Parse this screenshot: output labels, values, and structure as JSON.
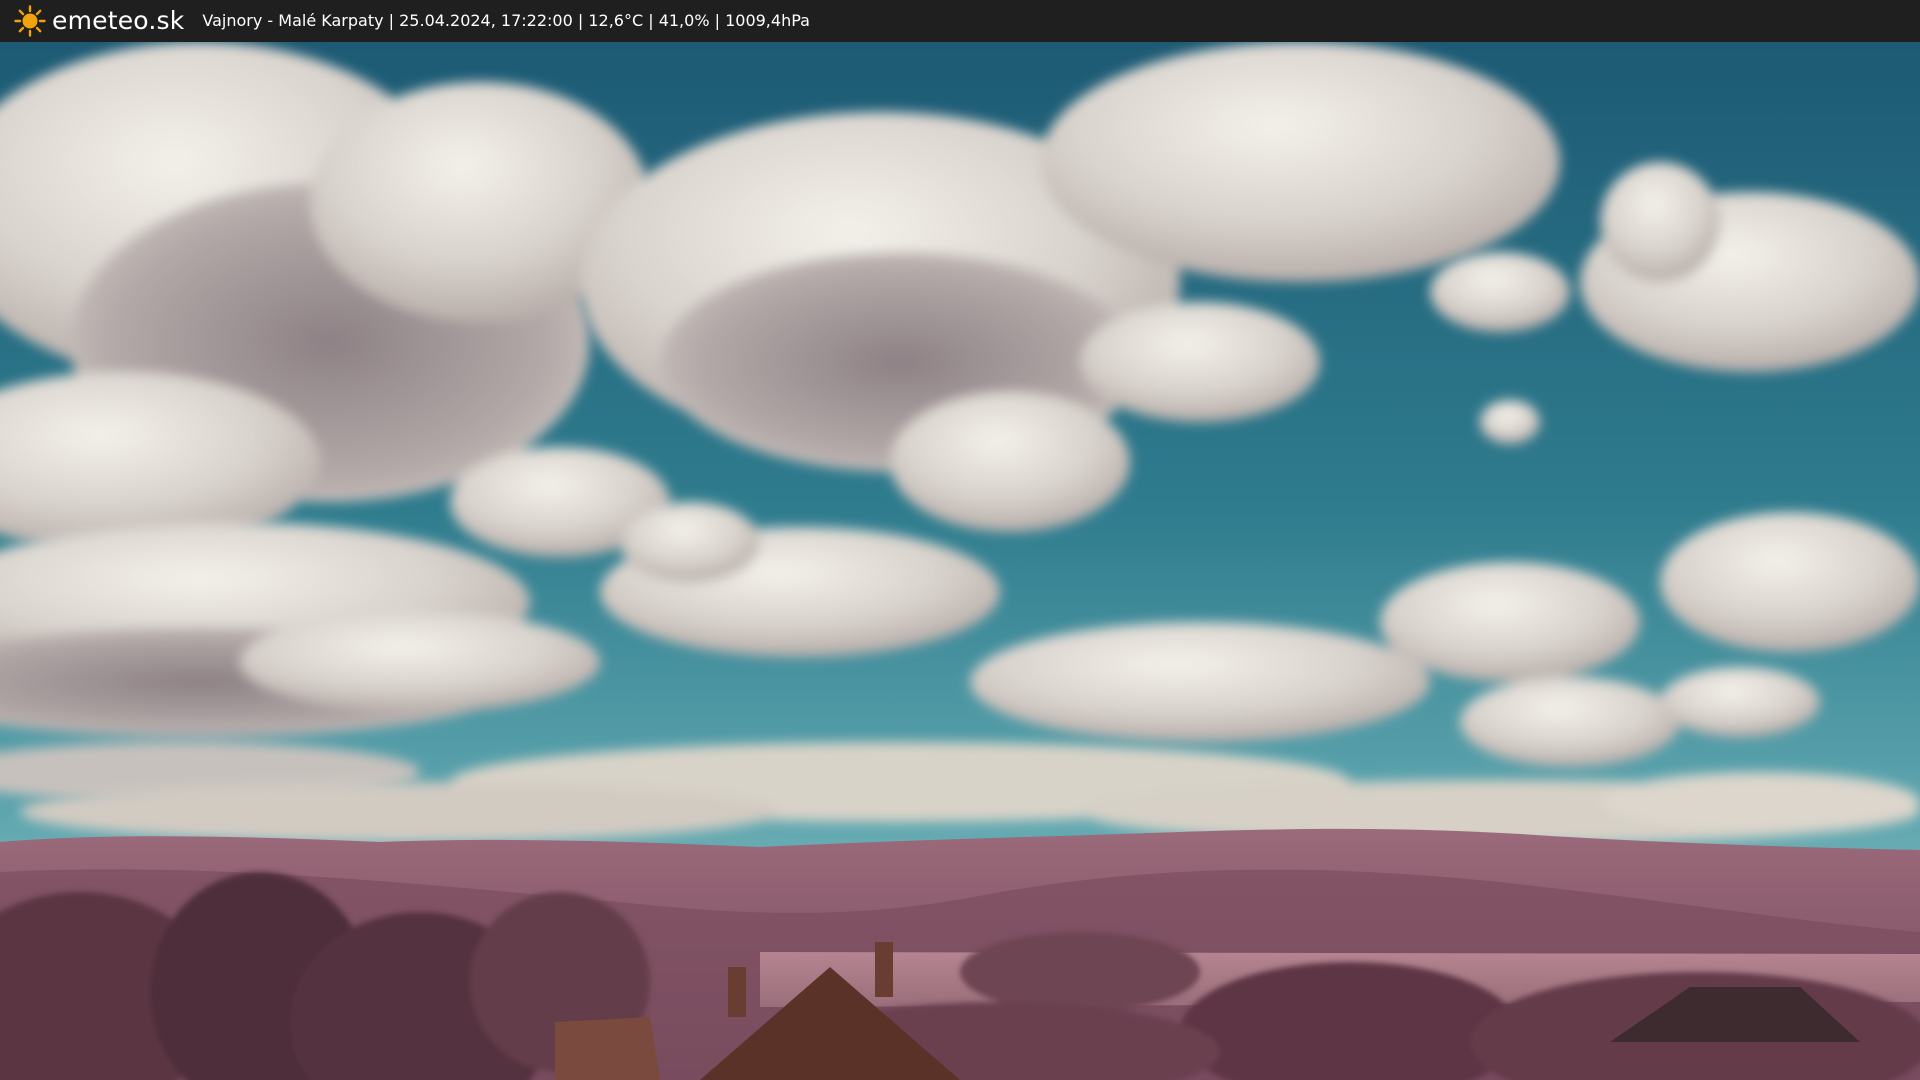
{
  "header": {
    "brand": "emeteo.sk",
    "caption": "Vajnory - Malé Karpaty | 25.04.2024, 17:22:00 | 12,6°C | 41,0% | 1009,4hPa",
    "logo_icon": "sun-icon"
  },
  "colors": {
    "bar_background": "#1f1f1f",
    "sun": "#f2a20c",
    "sky_top": "#1f5f78",
    "sky_bottom": "#6fb1b8",
    "ridge": "#8b5a6c",
    "foreground": "#5a3440"
  }
}
